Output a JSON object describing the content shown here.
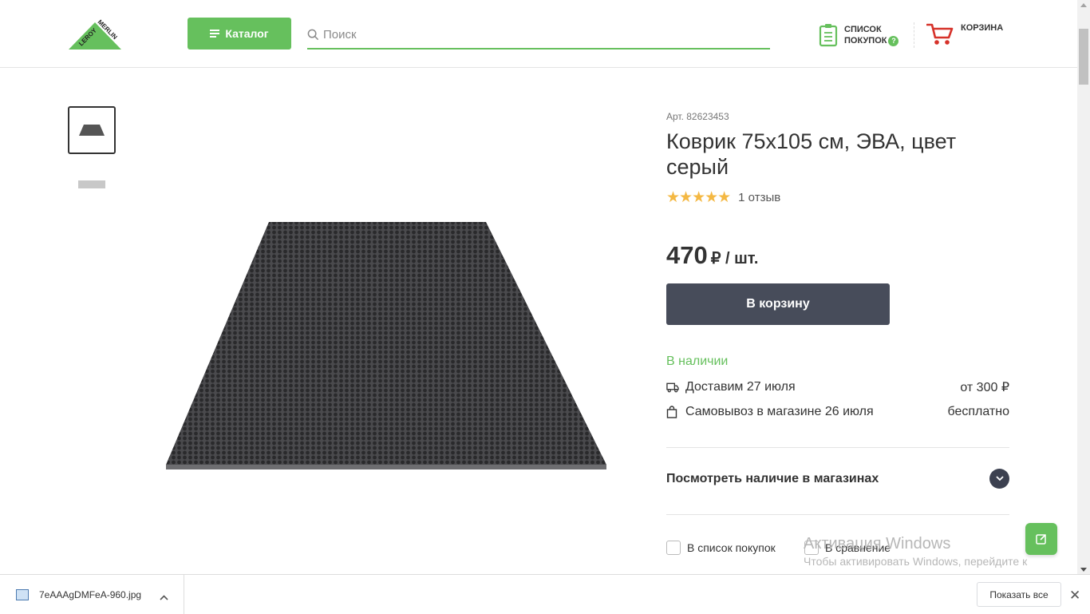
{
  "header": {
    "logo_text": "LEROY MERLIN",
    "catalog_label": "Каталог",
    "search_placeholder": "Поиск",
    "shopping_list_line1": "СПИСОК",
    "shopping_list_line2": "ПОКУПОК",
    "help_badge": "?",
    "cart_label": "КОРЗИНА"
  },
  "product": {
    "article": "Арт. 82623453",
    "title": "Коврик 75x105 см, ЭВА, цвет серый",
    "stars": "★★★★★",
    "rating_value": 5,
    "reviews": "1 отзыв",
    "price": "470",
    "price_unit": "₽ / шт.",
    "add_to_cart": "В корзину",
    "stock_status": "В наличии",
    "delivery_label": "Доставим 27 июля",
    "delivery_price": "от 300 ₽",
    "pickup_label": "Самовывоз в магазине 26 июля",
    "pickup_price": "бесплатно",
    "check_stores": "Посмотреть наличие в магазинах",
    "add_to_list": "В список покупок",
    "compare": "В сравнение"
  },
  "watermark": {
    "line1": "Активация Windows",
    "line2": "Чтобы активировать Windows, перейдите к параметрам компьютера."
  },
  "downloads": {
    "file_name": "7eAAAgDMFeA-960.jpg",
    "show_all": "Показать все",
    "close": "✕"
  },
  "colors": {
    "brand_green": "#66c05d",
    "button_dark": "#474c5a",
    "star": "#f4b843"
  }
}
